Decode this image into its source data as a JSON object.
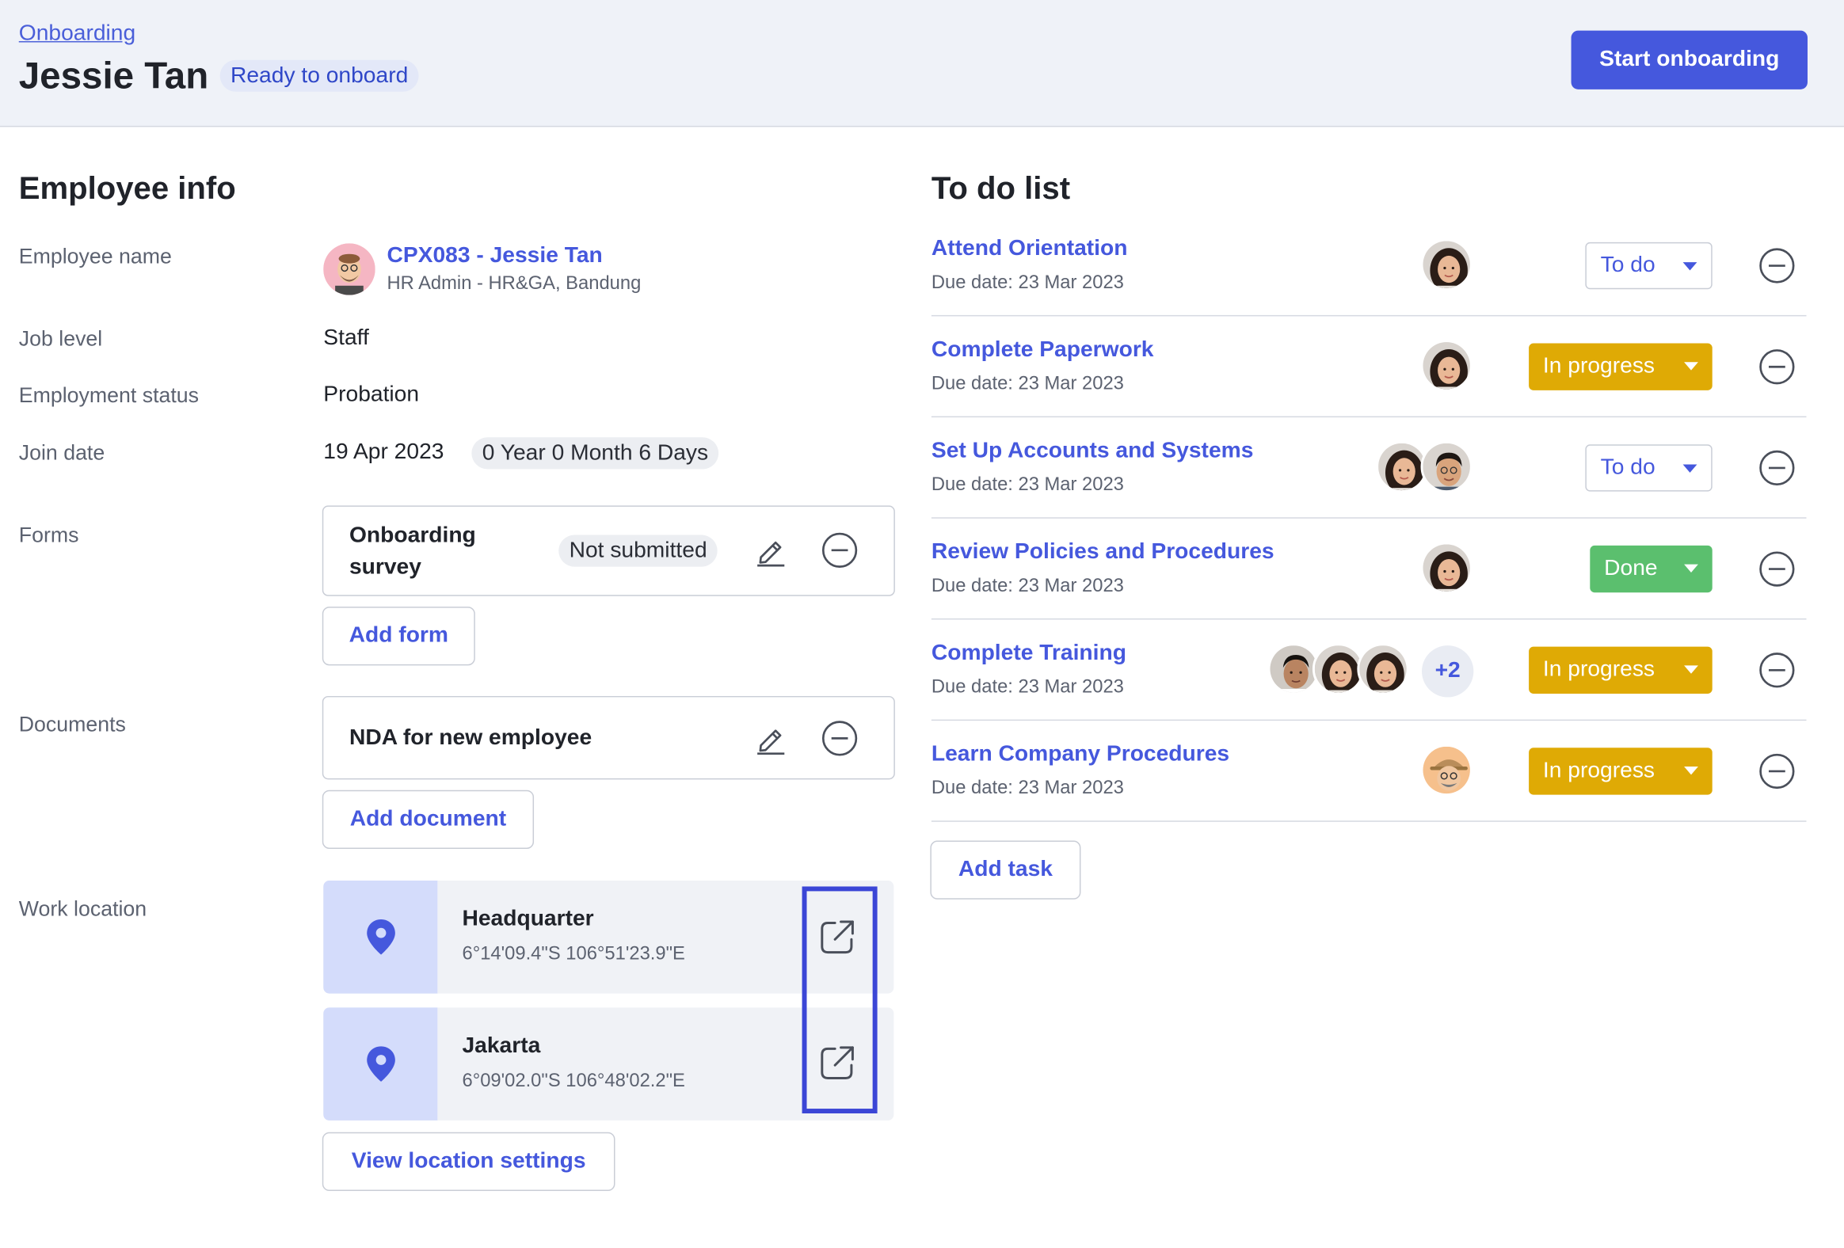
{
  "header": {
    "breadcrumb": "Onboarding",
    "title": "Jessie Tan",
    "status": "Ready to onboard",
    "start_button": "Start onboarding"
  },
  "employee_info": {
    "section_title": "Employee info",
    "labels": {
      "name": "Employee name",
      "job_level": "Job level",
      "employment_status": "Employment status",
      "join_date": "Join date",
      "forms": "Forms",
      "documents": "Documents",
      "work_location": "Work location"
    },
    "employee": {
      "name": "CPX083 - Jessie Tan",
      "role": "HR Admin - HR&GA, Bandung"
    },
    "job_level": "Staff",
    "employment_status": "Probation",
    "join_date": "19 Apr 2023",
    "tenure": "0 Year 0 Month 6 Days",
    "forms": [
      {
        "title_line1": "Onboarding",
        "title_line2": "survey",
        "status": "Not submitted"
      }
    ],
    "add_form_label": "Add form",
    "documents": [
      {
        "title": "NDA for new employee"
      }
    ],
    "add_document_label": "Add document",
    "locations": [
      {
        "name": "Headquarter",
        "coords": "6°14'09.4\"S 106°51'23.9\"E"
      },
      {
        "name": "Jakarta",
        "coords": "6°09'02.0\"S 106°48'02.2\"E"
      }
    ],
    "view_location_label": "View location settings"
  },
  "todo": {
    "section_title": "To do list",
    "add_task_label": "Add task",
    "items": [
      {
        "title": "Attend Orientation",
        "due": "Due date: 23 Mar 2023",
        "status": "To do"
      },
      {
        "title": "Complete Paperwork",
        "due": "Due date: 23 Mar 2023",
        "status": "In progress"
      },
      {
        "title": "Set Up Accounts and Systems",
        "due": "Due date: 23 Mar 2023",
        "status": "To do"
      },
      {
        "title": "Review Policies and Procedures",
        "due": "Due date: 23 Mar 2023",
        "status": "Done"
      },
      {
        "title": "Complete Training",
        "due": "Due date: 23 Mar 2023",
        "status": "In progress",
        "more": "+2"
      },
      {
        "title": "Learn Company Procedures",
        "due": "Due date: 23 Mar 2023",
        "status": "In progress"
      }
    ]
  },
  "colors": {
    "accent": "#4558dd",
    "in_progress": "#dfaa05",
    "done": "#5bbf6e",
    "highlight": "#3b46d6"
  }
}
